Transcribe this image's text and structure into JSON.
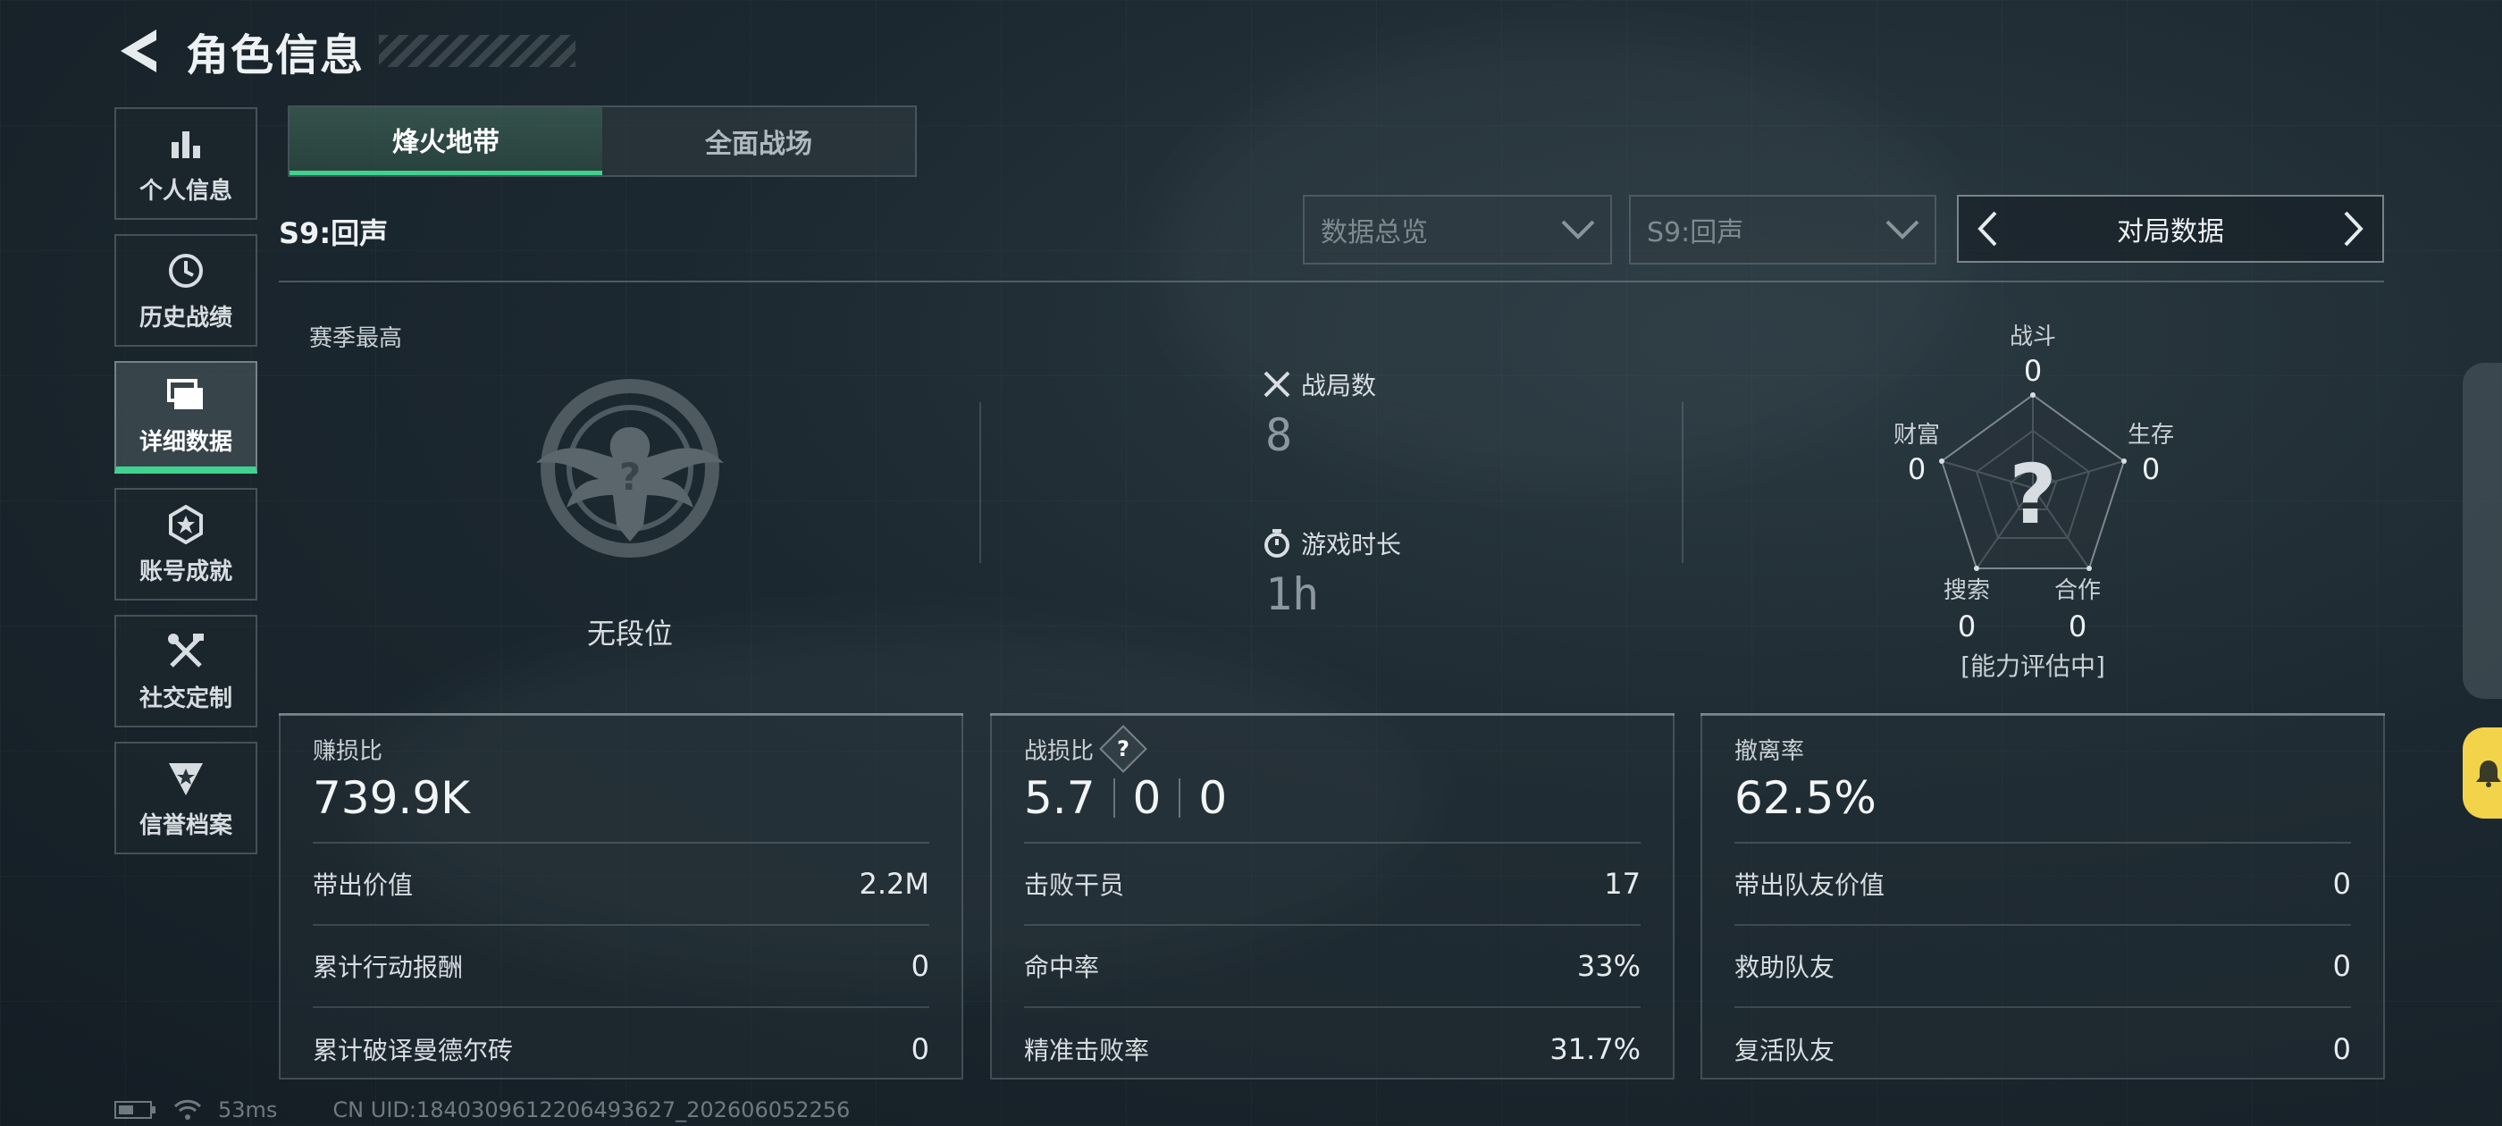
{
  "header": {
    "title": "角色信息"
  },
  "nav": {
    "items": [
      {
        "label": "个人信息",
        "icon": "bar-chart-icon",
        "active": false
      },
      {
        "label": "历史战绩",
        "icon": "history-icon",
        "active": false
      },
      {
        "label": "详细数据",
        "icon": "folder-icon",
        "active": true
      },
      {
        "label": "账号成就",
        "icon": "achievement-icon",
        "active": false
      },
      {
        "label": "社交定制",
        "icon": "tools-icon",
        "active": false
      },
      {
        "label": "信誉档案",
        "icon": "credit-icon",
        "active": false
      }
    ]
  },
  "mode_tabs": [
    {
      "label": "烽火地带",
      "active": true
    },
    {
      "label": "全面战场",
      "active": false
    }
  ],
  "season": {
    "label": "S9:回声"
  },
  "filters": {
    "overview": "数据总览",
    "season": "S9:回声",
    "switcher": "对局数据"
  },
  "season_best": {
    "label": "赛季最高",
    "rank": "无段位"
  },
  "summary": {
    "matches": {
      "label": "战局数",
      "value": "8"
    },
    "playtime": {
      "label": "游戏时长",
      "value": "1h"
    }
  },
  "radar": {
    "combat": {
      "label": "战斗",
      "value": "0"
    },
    "survival": {
      "label": "生存",
      "value": "0"
    },
    "cooperation": {
      "label": "合作",
      "value": "0"
    },
    "search": {
      "label": "搜索",
      "value": "0"
    },
    "wealth": {
      "label": "财富",
      "value": "0"
    },
    "status": "[能力评估中]",
    "center_mark": "?"
  },
  "cards": {
    "profit": {
      "title": "赚损比",
      "main": "739.9K",
      "rows": [
        {
          "label": "带出价值",
          "value": "2.2M"
        },
        {
          "label": "累计行动报酬",
          "value": "0"
        },
        {
          "label": "累计破译曼德尔砖",
          "value": "0"
        }
      ]
    },
    "combat": {
      "title": "战损比",
      "help": "?",
      "main": [
        "5.7",
        "0",
        "0"
      ],
      "rows": [
        {
          "label": "击败干员",
          "value": "17"
        },
        {
          "label": "命中率",
          "value": "33%"
        },
        {
          "label": "精准击败率",
          "value": "31.7%"
        }
      ]
    },
    "extract": {
      "title": "撤离率",
      "main": "62.5%",
      "rows": [
        {
          "label": "带出队友价值",
          "value": "0"
        },
        {
          "label": "救助队友",
          "value": "0"
        },
        {
          "label": "复活队友",
          "value": "0"
        }
      ]
    }
  },
  "footer": {
    "ping": "53ms",
    "uid": "CN UID:1840309612206493627_202606052256"
  },
  "colors": {
    "accent": "#3fd38f",
    "highlight": "#f2d34a"
  }
}
